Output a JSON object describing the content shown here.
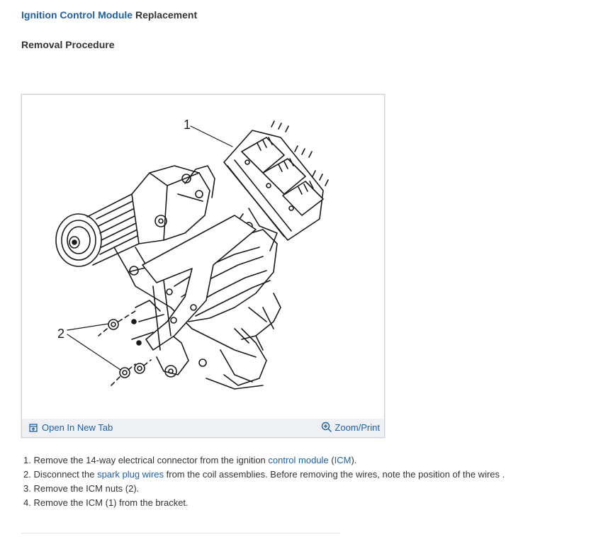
{
  "header": {
    "title_link": "Ignition Control Module",
    "title_rest": " Replacement",
    "subtitle": "Removal Procedure"
  },
  "figure": {
    "callouts": [
      "1",
      "2"
    ],
    "open_tab_label": "Open In New Tab",
    "open_tab_icon": "open-new-tab-icon",
    "zoom_label": "Zoom/Print",
    "zoom_icon": "zoom-magnifier-icon"
  },
  "steps": [
    {
      "num": "1.",
      "pre": "Remove the 14-way electrical connector from the ignition ",
      "link1": "control module",
      "mid": " (",
      "link2": "ICM",
      "post": ")."
    },
    {
      "num": "2.",
      "pre": "Disconnect the ",
      "link1": "spark plug wires",
      "post": " from the coil assemblies. Before removing the wires, note the position of the wires ."
    },
    {
      "num": "3.",
      "text": "Remove the ICM nuts (2)."
    },
    {
      "num": "4.",
      "text": "Remove the ICM (1) from the bracket."
    }
  ],
  "colors": {
    "link": "#1f5fa8",
    "text": "#333333",
    "bar": "#eef0f3"
  }
}
